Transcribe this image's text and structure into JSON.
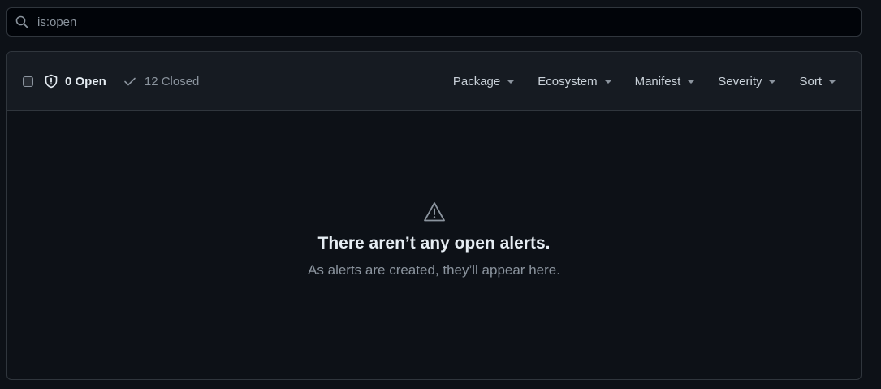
{
  "search": {
    "value": "is:open",
    "icon": "search-icon"
  },
  "header": {
    "open_label": "0 Open",
    "closed_label": "12 Closed",
    "filters": [
      {
        "label": "Package"
      },
      {
        "label": "Ecosystem"
      },
      {
        "label": "Manifest"
      },
      {
        "label": "Severity"
      },
      {
        "label": "Sort"
      }
    ]
  },
  "blankslate": {
    "icon": "alert-icon",
    "title": "There aren’t any open alerts.",
    "description": "As alerts are created, they’ll appear here."
  },
  "colors": {
    "background": "#0d1117",
    "header_bg": "#161b22",
    "border": "#30363d",
    "text_primary": "#e6edf3",
    "text_muted": "#8b949e"
  }
}
